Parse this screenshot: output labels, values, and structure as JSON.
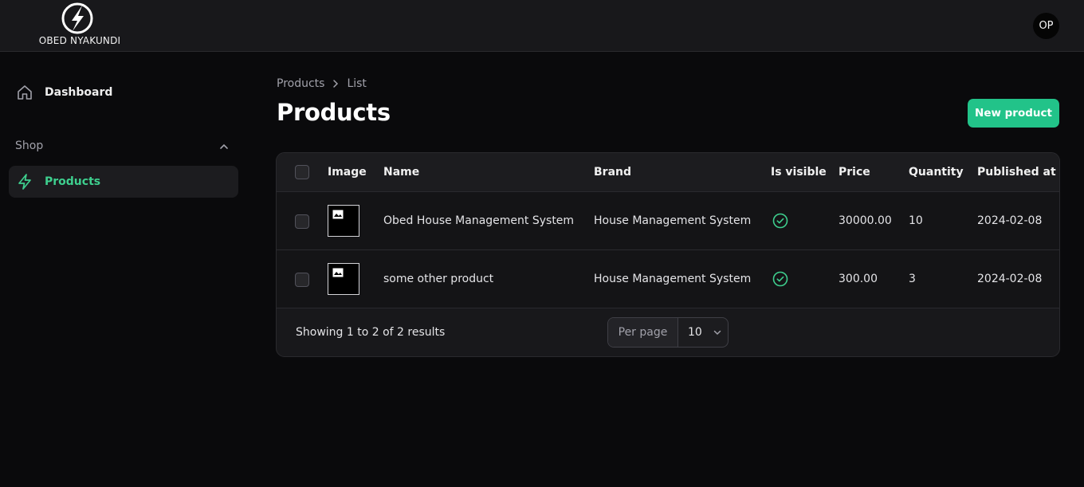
{
  "header": {
    "brand": "OBED NYAKUNDI",
    "avatar_initials": "OP"
  },
  "sidebar": {
    "dashboard_label": "Dashboard",
    "group_label": "Shop",
    "products_label": "Products"
  },
  "breadcrumb": {
    "items": [
      "Products",
      "List"
    ]
  },
  "page": {
    "title": "Products",
    "new_button": "New product"
  },
  "table": {
    "columns": [
      "Image",
      "Name",
      "Brand",
      "Is visible",
      "Price",
      "Quantity",
      "Published at"
    ],
    "rows": [
      {
        "name": "Obed House Management System",
        "brand": "House Management System",
        "visible": true,
        "price": "30000.00",
        "quantity": "10",
        "published_at": "2024-02-08"
      },
      {
        "name": "some other product",
        "brand": "House Management System",
        "visible": true,
        "price": "300.00",
        "quantity": "3",
        "published_at": "2024-02-08"
      }
    ],
    "footer": {
      "summary": "Showing 1 to 2 of 2 results",
      "per_page_label": "Per page",
      "per_page_value": "10"
    }
  },
  "colors": {
    "accent": "#22c389",
    "active_nav": "#3ecf8e"
  }
}
